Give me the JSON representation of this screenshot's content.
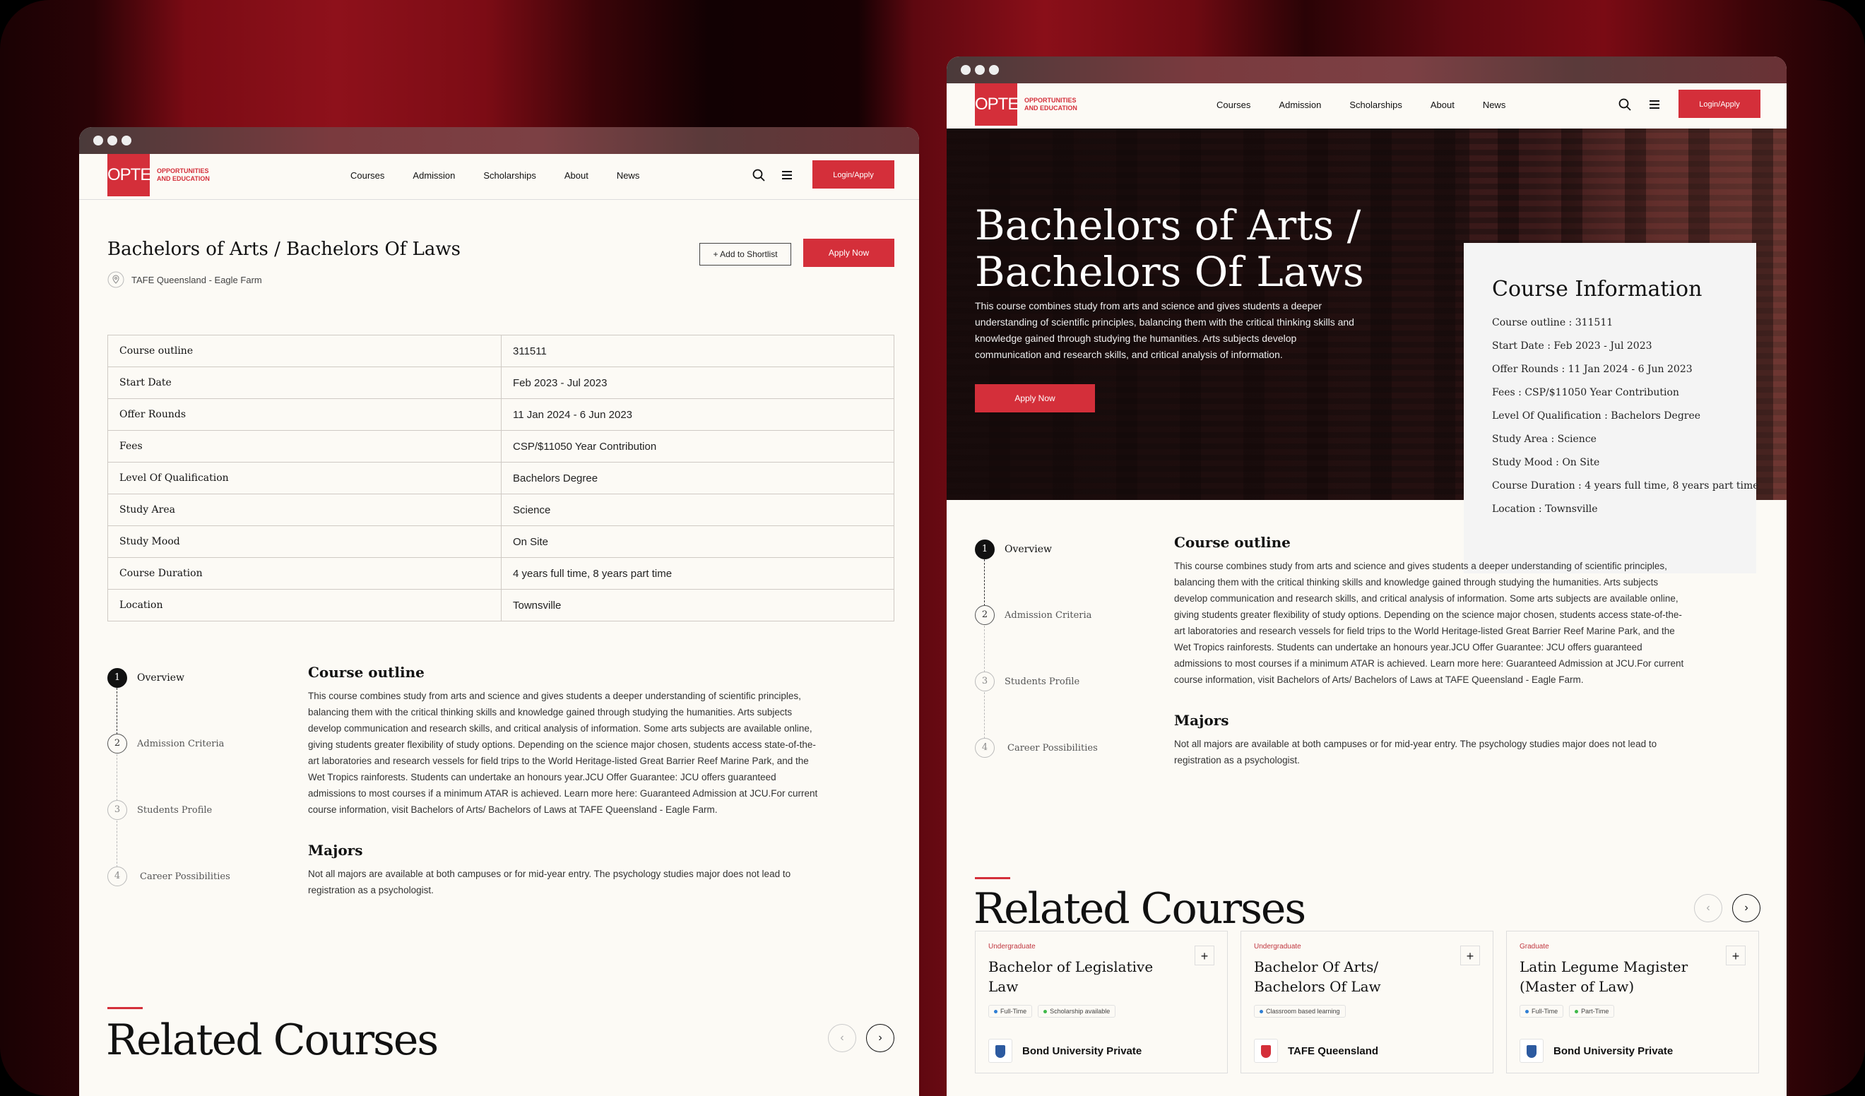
{
  "brand": {
    "logo": "OPTE",
    "tagline_line1": "OPPORTUNITIES",
    "tagline_line2": "AND EDUCATION",
    "accent_color": "#d42f3a"
  },
  "nav": {
    "items": [
      "Courses",
      "Admission",
      "Scholarships",
      "About",
      "News"
    ],
    "search_icon": "search-icon",
    "menu_icon": "hamburger-menu-icon",
    "login_label": "Login/Apply"
  },
  "course": {
    "title": "Bachelors of Arts / Bachelors Of Laws",
    "title_line1": "Bachelors of Arts /",
    "title_line2": "Bachelors Of Laws",
    "location": "TAFE Queensland - Eagle Farm",
    "shortlist_label": "Add to Shortlist",
    "apply_label": "Apply Now",
    "hero_summary": "This course combines study from arts and science and gives students a deeper understanding of scientific principles, balancing them with the critical thinking skills and knowledge gained through studying the humanities. Arts subjects develop communication and research skills, and critical analysis of information."
  },
  "details": [
    {
      "label": "Course outline",
      "value": "311511"
    },
    {
      "label": "Start Date",
      "value": "Feb 2023 - Jul 2023"
    },
    {
      "label": "Offer Rounds",
      "value": "11 Jan 2024 - 6 Jun 2023"
    },
    {
      "label": "Fees",
      "value": "CSP/$11050 Year Contribution"
    },
    {
      "label": "Level Of Qualification",
      "value": "Bachelors Degree"
    },
    {
      "label": "Study Area",
      "value": "Science"
    },
    {
      "label": "Study Mood",
      "value": "On Site"
    },
    {
      "label": "Course Duration",
      "value": "4 years full time, 8 years part time"
    },
    {
      "label": "Location",
      "value": "Townsville"
    }
  ],
  "info_card": {
    "title": "Course Information",
    "rows": [
      "Course outline : 311511",
      "Start Date : Feb 2023 - Jul 2023",
      "Offer Rounds : 11 Jan 2024 - 6 Jun 2023",
      "Fees : CSP/$11050 Year Contribution",
      "Level Of Qualification : Bachelors Degree",
      "Study Area : Science",
      "Study Mood : On Site",
      "Course Duration : 4 years full time, 8 years part time",
      "Location : Townsville"
    ]
  },
  "steps": [
    {
      "num": "1",
      "label": "Overview",
      "active": true
    },
    {
      "num": "2",
      "label": "Admission Criteria"
    },
    {
      "num": "3",
      "label": "Students Profile"
    },
    {
      "num": "4",
      "label": "Career Possibilities"
    }
  ],
  "outline": {
    "heading": "Course outline",
    "body": "This course combines study from arts and science and gives students a deeper understanding of scientific principles, balancing them with the critical thinking skills and knowledge gained through studying the humanities. Arts subjects develop communication and research skills, and critical analysis of information. Some arts subjects are available online, giving students greater flexibility of study options. Depending on the science major chosen, students access state-of-the-art laboratories and research vessels for field trips to the World Heritage-listed Great Barrier Reef Marine Park, and the Wet Tropics rainforests. Students can undertake an honours year.JCU Offer Guarantee: JCU offers guaranteed admissions to most courses if a minimum ATAR is achieved. Learn more here: Guaranteed Admission at JCU.For current course information, visit Bachelors of Arts/ Bachelors of Laws at TAFE Queensland - Eagle Farm.",
    "majors_heading": "Majors",
    "majors_body": "Not all majors are available at both campuses or for mid-year entry. The psychology studies major does not lead to registration as a psychologist."
  },
  "related": {
    "heading": "Related Courses",
    "prev_icon": "chevron-left-icon",
    "next_icon": "chevron-right-icon",
    "cards": [
      {
        "level": "Undergraduate",
        "title": "Bachelor of Legislative Law",
        "tags": [
          {
            "label": "Full-Time",
            "color": "#2f7fd4"
          },
          {
            "label": "Scholarship available",
            "color": "#3fb94a"
          }
        ],
        "university": "Bond University Private"
      },
      {
        "level": "Undergraduate",
        "title": "Bachelor Of Arts/ Bachelors Of Law",
        "tags": [
          {
            "label": "Classroom based learning",
            "color": "#2f7fd4"
          }
        ],
        "university": "TAFE Queensland"
      },
      {
        "level": "Graduate",
        "title": "Latin Legume Magister (Master of Law)",
        "tags": [
          {
            "label": "Full-Time",
            "color": "#2f7fd4"
          },
          {
            "label": "Part-Time",
            "color": "#3fb94a"
          }
        ],
        "university": "Bond University Private"
      }
    ]
  }
}
